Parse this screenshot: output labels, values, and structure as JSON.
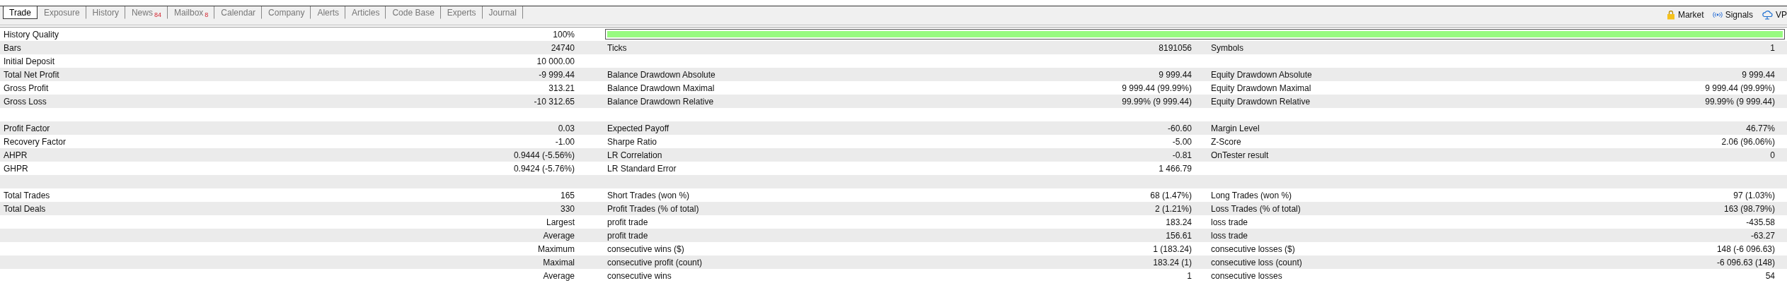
{
  "tabs": [
    {
      "label": "Trade",
      "selected": true
    },
    {
      "label": "Exposure",
      "selected": false
    },
    {
      "label": "History",
      "selected": false
    },
    {
      "label": "News",
      "badge": "84",
      "selected": false
    },
    {
      "label": "Mailbox",
      "badge": "8",
      "selected": false
    },
    {
      "label": "Calendar",
      "selected": false
    },
    {
      "label": "Company",
      "selected": false
    },
    {
      "label": "Alerts",
      "selected": false
    },
    {
      "label": "Articles",
      "selected": false
    },
    {
      "label": "Code Base",
      "selected": false
    },
    {
      "label": "Experts",
      "selected": false
    },
    {
      "label": "Journal",
      "selected": false
    }
  ],
  "toolbar_links": [
    {
      "label": "Market",
      "kind": "bag"
    },
    {
      "label": "Signals",
      "kind": "signal"
    },
    {
      "label": "VP",
      "kind": "cloud"
    }
  ],
  "rows": [
    {
      "kind": "quality",
      "label": "History Quality",
      "value": "100%",
      "level": 1
    },
    {
      "kind": "stats",
      "columns": [
        {
          "label": "Bars",
          "value": "24740"
        },
        {
          "label": "Ticks",
          "value": "8191056"
        },
        {
          "label": "Symbols",
          "value": "1"
        }
      ]
    },
    {
      "kind": "stats",
      "columns": [
        {
          "label": "Initial Deposit",
          "value": "10 000.00"
        }
      ]
    },
    {
      "kind": "stats",
      "columns": [
        {
          "label": "Total Net Profit",
          "value": "-9 999.44"
        },
        {
          "label": "Balance Drawdown Absolute",
          "value": "9 999.44"
        },
        {
          "label": "Equity Drawdown Absolute",
          "value": "9 999.44"
        }
      ]
    },
    {
      "kind": "stats",
      "columns": [
        {
          "label": "Gross Profit",
          "value": "313.21"
        },
        {
          "label": "Balance Drawdown Maximal",
          "value": "9 999.44 (99.99%)"
        },
        {
          "label": "Equity Drawdown Maximal",
          "value": "9 999.44 (99.99%)"
        }
      ]
    },
    {
      "kind": "stats",
      "columns": [
        {
          "label": "Gross Loss",
          "value": "-10 312.65"
        },
        {
          "label": "Balance Drawdown Relative",
          "value": "99.99% (9 999.44)"
        },
        {
          "label": "Equity Drawdown Relative",
          "value": "99.99% (9 999.44)"
        }
      ]
    },
    {
      "kind": "blank"
    },
    {
      "kind": "stats",
      "columns": [
        {
          "label": "Profit Factor",
          "value": "0.03"
        },
        {
          "label": "Expected Payoff",
          "value": "-60.60"
        },
        {
          "label": "Margin Level",
          "value": "46.77%"
        }
      ]
    },
    {
      "kind": "stats",
      "columns": [
        {
          "label": "Recovery Factor",
          "value": "-1.00"
        },
        {
          "label": "Sharpe Ratio",
          "value": "-5.00"
        },
        {
          "label": "Z-Score",
          "value": "2.06 (96.06%)"
        }
      ]
    },
    {
      "kind": "stats",
      "columns": [
        {
          "label": "AHPR",
          "value": "0.9444 (-5.56%)"
        },
        {
          "label": "LR Correlation",
          "value": "-0.81"
        },
        {
          "label": "OnTester result",
          "value": "0"
        }
      ]
    },
    {
      "kind": "stats",
      "columns": [
        {
          "label": "GHPR",
          "value": "0.9424 (-5.76%)"
        },
        {
          "label": "LR Standard Error",
          "value": "1 466.79"
        }
      ]
    },
    {
      "kind": "blank"
    },
    {
      "kind": "stats",
      "columns": [
        {
          "label": "Total Trades",
          "value": "165"
        },
        {
          "label": "Short Trades (won %)",
          "value": "68 (1.47%)"
        },
        {
          "label": "Long Trades (won %)",
          "value": "97 (1.03%)"
        }
      ]
    },
    {
      "kind": "stats",
      "columns": [
        {
          "label": "Total Deals",
          "value": "330"
        },
        {
          "label": "Profit Trades (% of total)",
          "value": "2 (1.21%)"
        },
        {
          "label": "Loss Trades (% of total)",
          "value": "163 (98.79%)"
        }
      ]
    },
    {
      "kind": "stats",
      "columns": [
        {
          "value": "Largest"
        },
        {
          "label": "profit trade",
          "value": "183.24"
        },
        {
          "label": "loss trade",
          "value": "-435.58"
        }
      ]
    },
    {
      "kind": "stats",
      "columns": [
        {
          "value": "Average"
        },
        {
          "label": "profit trade",
          "value": "156.61"
        },
        {
          "label": "loss trade",
          "value": "-63.27"
        }
      ]
    },
    {
      "kind": "stats",
      "columns": [
        {
          "value": "Maximum"
        },
        {
          "label": "consecutive wins ($)",
          "value": "1 (183.24)"
        },
        {
          "label": "consecutive losses ($)",
          "value": "148 (-6 096.63)"
        }
      ]
    },
    {
      "kind": "stats",
      "columns": [
        {
          "value": "Maximal"
        },
        {
          "label": "consecutive profit (count)",
          "value": "183.24 (1)"
        },
        {
          "label": "consecutive loss (count)",
          "value": "-6 096.63 (148)"
        }
      ]
    },
    {
      "kind": "stats",
      "columns": [
        {
          "value": "Average"
        },
        {
          "label": "consecutive wins",
          "value": "1"
        },
        {
          "label": "consecutive losses",
          "value": "54"
        }
      ]
    }
  ]
}
